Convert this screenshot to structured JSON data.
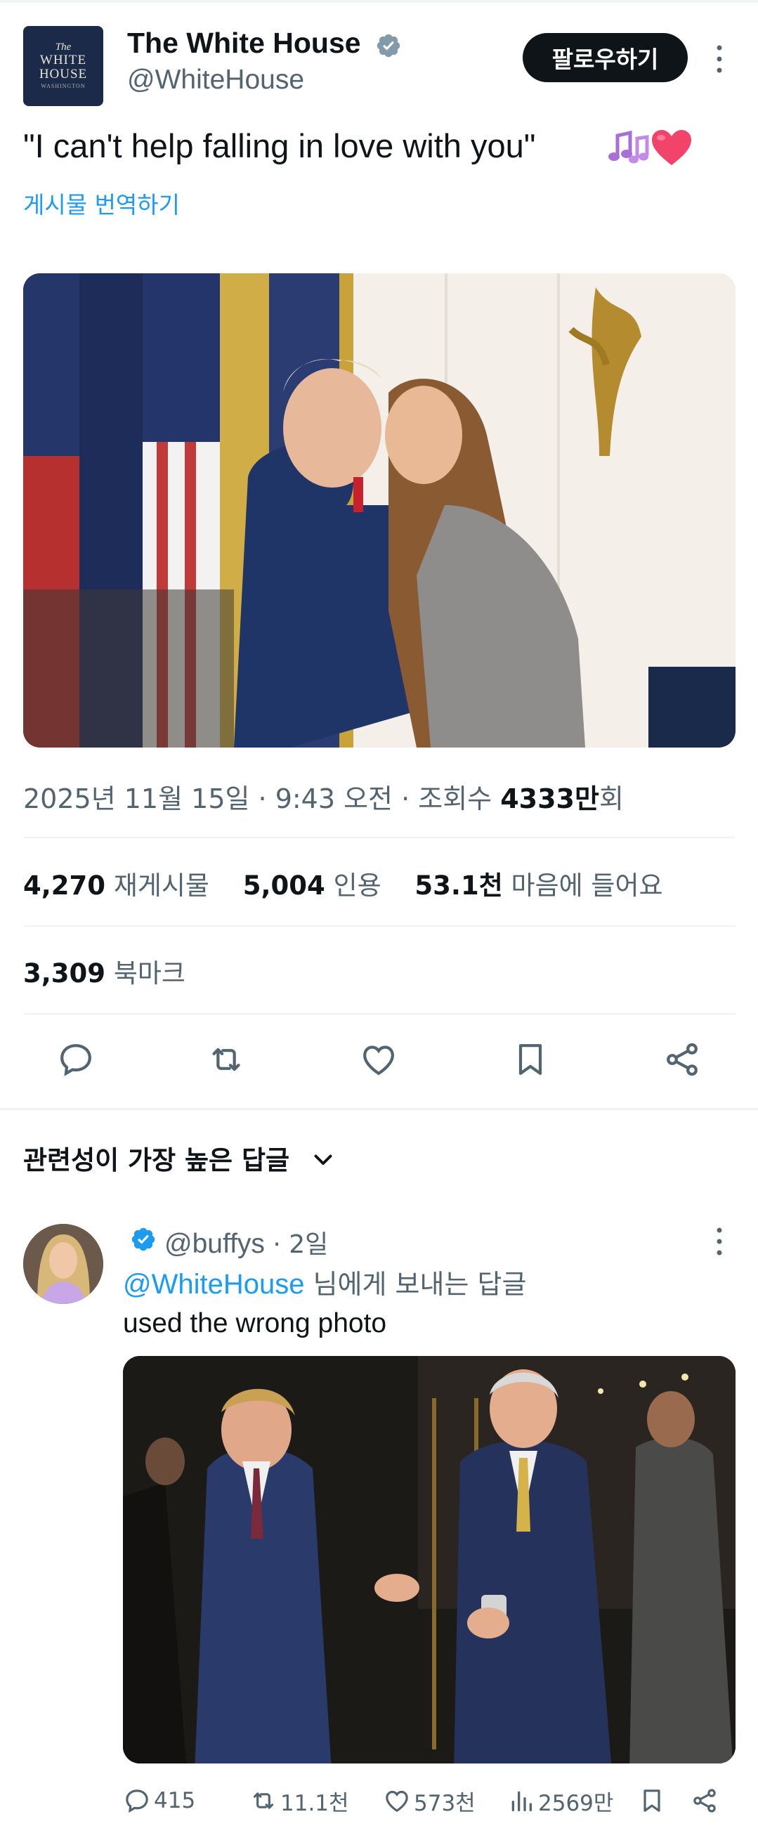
{
  "tweet": {
    "author_name": "The White House",
    "author_handle": "@WhiteHouse",
    "avatar_text": [
      "The",
      "WHITE",
      "HOUSE",
      "WASHINGTON"
    ],
    "follow_label": "팔로우하기",
    "text": "\"I can't help falling in love with you\"",
    "emoji": [
      "notes-emoji",
      "heart-emoji"
    ],
    "translate_label": "게시물 번역하기",
    "date_time": "2025년 11월 15일 · 9:43 오전 · 조회수 ",
    "views_number": "4333만",
    "views_suffix": "회",
    "reposts_count": "4,270",
    "reposts_label": "재게시물",
    "quotes_count": "5,004",
    "quotes_label": "인용",
    "likes_count": "53.1천",
    "likes_label": "마음에 들어요",
    "bookmarks_count": "3,309",
    "bookmarks_label": "북마크",
    "action_icons": [
      "reply-icon",
      "repost-icon",
      "like-icon",
      "bookmark-icon",
      "share-icon"
    ]
  },
  "replies_sort": {
    "label": "관련성이 가장 높은 답글"
  },
  "reply": {
    "handle": "@buffys",
    "time": " · 2일",
    "reply_to_mention": "@WhiteHouse",
    "reply_to_suffix": " 님에게 보내는 답글",
    "text": "used the wrong photo",
    "replies": "415",
    "reposts": "11.1천",
    "likes": "573천",
    "views": "2569만"
  },
  "colors": {
    "accent": "#1d9bf0",
    "text_primary": "#0f1419",
    "text_secondary": "#536471",
    "divider": "#eff3f4"
  }
}
